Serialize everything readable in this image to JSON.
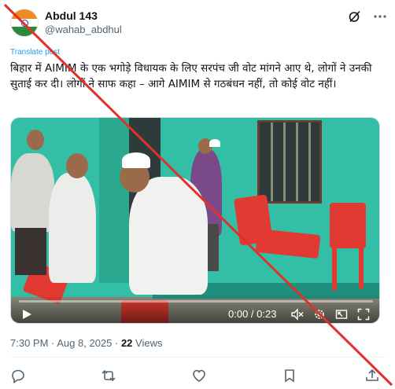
{
  "author": {
    "display_name": "Abdul 143",
    "handle": "@wahab_abdhul"
  },
  "translate_label": "Translate post",
  "tweet_text": "बिहार में AIMIM के एक भगोड़े विधायक के लिए सरपंच जी वोट मांगने आए थे, लोगों ने उनकी सुताई कर दी। लोगों ने साफ कहा – आगे AIMIM से गठबंधन नहीं, तो कोई वोट नहीं।",
  "video": {
    "current_time": "0:00",
    "duration": "0:23",
    "time_display": "0:00 / 0:23",
    "progress": 0.0
  },
  "meta": {
    "time": "7:30 PM",
    "date": "Aug 8, 2025",
    "separator": " · ",
    "views_count": "22",
    "views_label": " Views"
  },
  "icons": [
    "grok-icon",
    "more-icon",
    "play-icon",
    "mute-icon",
    "settings-icon",
    "pip-icon",
    "fullscreen-icon",
    "reply-icon",
    "repost-icon",
    "like-icon",
    "bookmark-icon",
    "share-icon"
  ],
  "colors": {
    "accent": "#1d9bf0",
    "strike_line": "#e0322c",
    "muted_text": "#536471"
  }
}
